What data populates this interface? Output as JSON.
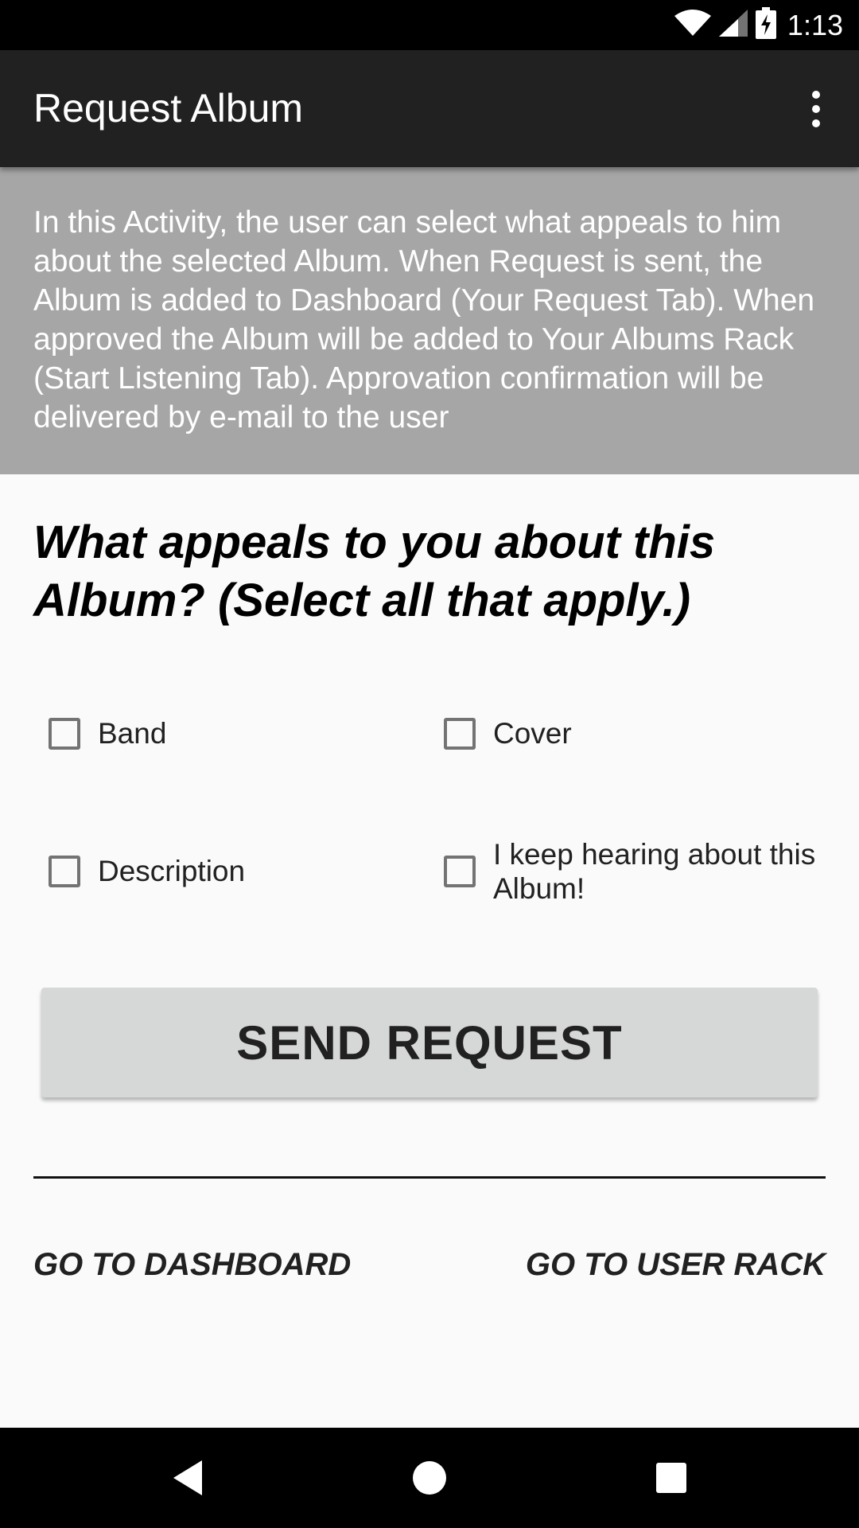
{
  "status_bar": {
    "time": "1:13",
    "icons": [
      "wifi-icon",
      "signal-icon",
      "battery-charging-icon"
    ]
  },
  "app_bar": {
    "title": "Request Album",
    "overflow_icon": "more-vert-icon"
  },
  "info_banner": {
    "text": "In this Activity, the user can select what appeals to him about the selected Album. When Request is sent, the Album is added to Dashboard (Your Request Tab). When approved the Album will be added to Your Albums Rack (Start Listening Tab). Approvation confirmation will be delivered by e-mail to the user"
  },
  "question": {
    "text": "What appeals to you about this Album? (Select all that apply.)"
  },
  "options": [
    {
      "label": "Band",
      "checked": false
    },
    {
      "label": "Cover",
      "checked": false
    },
    {
      "label": "Description",
      "checked": false
    },
    {
      "label": "I keep hearing about this Album!",
      "checked": false
    }
  ],
  "send_button": {
    "label": "SEND REQUEST"
  },
  "links": {
    "dashboard": "GO TO DASHBOARD",
    "user_rack": "GO TO USER RACK"
  },
  "nav_bar": {
    "back_icon": "back-icon",
    "home_icon": "home-icon",
    "recents_icon": "recents-icon"
  },
  "colors": {
    "app_bar": "#212121",
    "banner": "#a6a6a6",
    "button": "#d6d7d7",
    "background": "#fafafa"
  }
}
